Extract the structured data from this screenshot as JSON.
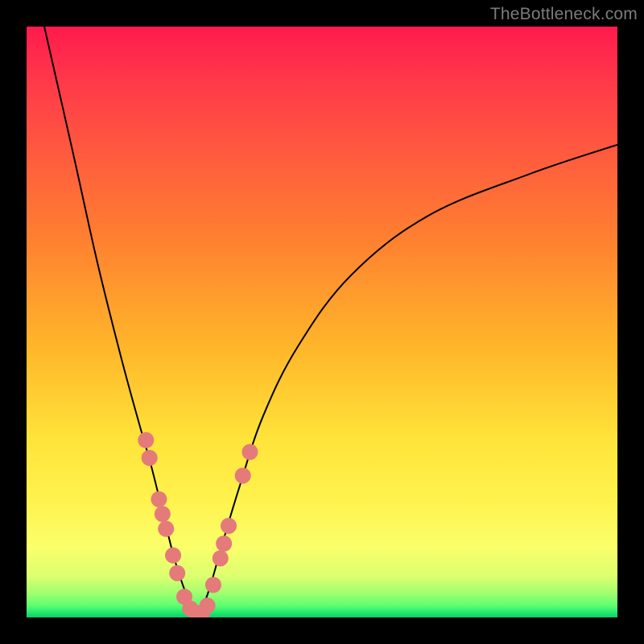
{
  "watermark": "TheBottleneck.com",
  "colors": {
    "frame": "#000000",
    "dot": "#e47a7a",
    "curve": "#000000",
    "gradient_stops": [
      "#ff1a4d",
      "#ff5c3e",
      "#ffb82a",
      "#fff24d",
      "#9dff6f",
      "#0dcc66"
    ]
  },
  "chart_data": {
    "type": "line",
    "title": "",
    "xlabel": "",
    "ylabel": "",
    "xlim": [
      0,
      100
    ],
    "ylim": [
      0,
      100
    ],
    "series": [
      {
        "name": "left-curve",
        "x": [
          3,
          8,
          12,
          16,
          19,
          21,
          23,
          25,
          27,
          28.5
        ],
        "y": [
          100,
          78,
          60,
          44,
          33,
          26,
          18,
          10,
          4,
          1
        ]
      },
      {
        "name": "right-curve",
        "x": [
          29.5,
          31,
          33,
          36,
          40,
          46,
          55,
          68,
          85,
          100
        ],
        "y": [
          1,
          5,
          12,
          22,
          34,
          46,
          58,
          68,
          75,
          80
        ]
      }
    ],
    "points": [
      {
        "name": "dot",
        "x": 20.2,
        "y": 30
      },
      {
        "name": "dot",
        "x": 20.8,
        "y": 27
      },
      {
        "name": "dot",
        "x": 22.4,
        "y": 20
      },
      {
        "name": "dot",
        "x": 23.0,
        "y": 17.5
      },
      {
        "name": "dot",
        "x": 23.6,
        "y": 15
      },
      {
        "name": "dot",
        "x": 24.8,
        "y": 10.5
      },
      {
        "name": "dot",
        "x": 25.5,
        "y": 7.5
      },
      {
        "name": "dot",
        "x": 26.7,
        "y": 3.5
      },
      {
        "name": "dot",
        "x": 27.7,
        "y": 1.5
      },
      {
        "name": "dot",
        "x": 28.7,
        "y": 0.8
      },
      {
        "name": "dot",
        "x": 29.7,
        "y": 0.8
      },
      {
        "name": "dot",
        "x": 30.6,
        "y": 2.0
      },
      {
        "name": "dot",
        "x": 31.6,
        "y": 5.5
      },
      {
        "name": "dot",
        "x": 32.8,
        "y": 10
      },
      {
        "name": "dot",
        "x": 33.4,
        "y": 12.5
      },
      {
        "name": "dot",
        "x": 34.2,
        "y": 15.5
      },
      {
        "name": "dot",
        "x": 36.6,
        "y": 24
      },
      {
        "name": "dot",
        "x": 37.8,
        "y": 28
      }
    ],
    "dot_radius_px": 10
  }
}
